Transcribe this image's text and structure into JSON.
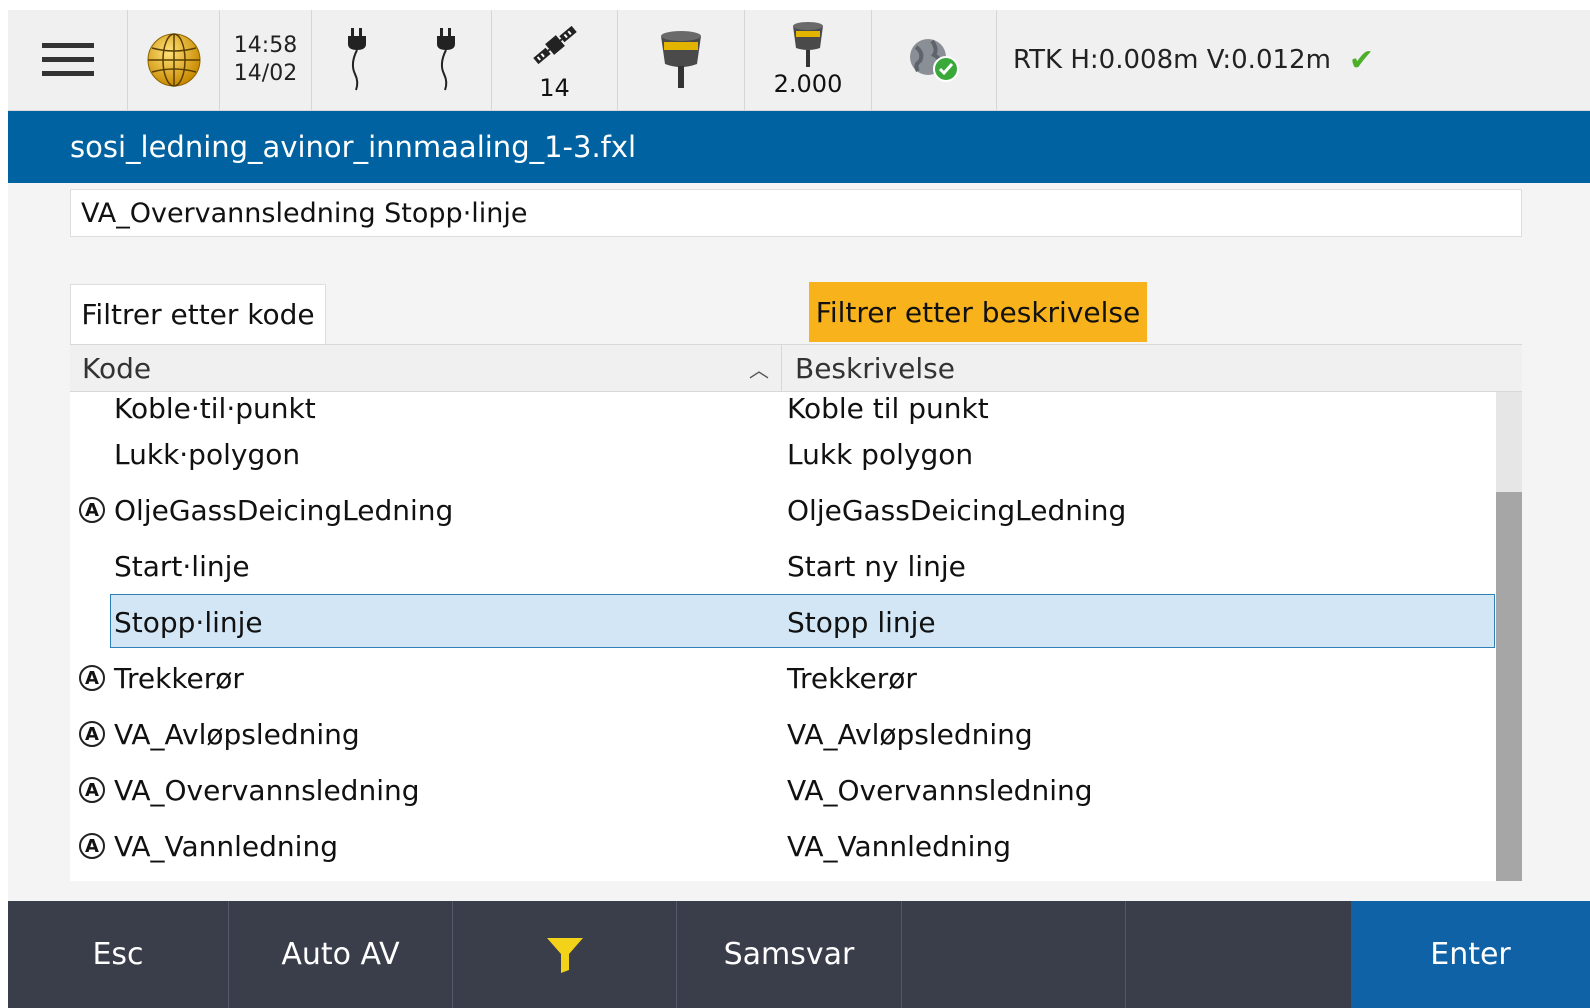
{
  "status": {
    "time": "14:58",
    "date": "14/02",
    "satellites": "14",
    "antenna_height": "2.000",
    "rtk_text": "RTK H:0.008m V:0.012m",
    "icons": [
      "menu-icon",
      "globe-icon",
      "plug-icon",
      "plug-icon",
      "satellite-icon",
      "gnss-receiver-icon",
      "receiver-height-icon",
      "network-globe-icon",
      "check-icon"
    ]
  },
  "title": "sosi_ledning_avinor_innmaaling_1-3.fxl",
  "code_field": "VA_Overvannsledning Stopp·linje",
  "filters": {
    "by_code": "Filtrer etter kode",
    "by_description": "Filtrer etter beskrivelse"
  },
  "table": {
    "headers": {
      "code": "Kode",
      "description": "Beskrivelse"
    },
    "rows": [
      {
        "code": "Koble·til·punkt",
        "description": "Koble til punkt",
        "attr": false
      },
      {
        "code": "Lukk·polygon",
        "description": "Lukk polygon",
        "attr": false
      },
      {
        "code": "OljeGassDeicingLedning",
        "description": "OljeGassDeicingLedning",
        "attr": true
      },
      {
        "code": "Start·linje",
        "description": "Start ny linje",
        "attr": false
      },
      {
        "code": "Stopp·linje",
        "description": "Stopp linje",
        "attr": false,
        "selected": true
      },
      {
        "code": "Trekkerør",
        "description": "Trekkerør",
        "attr": true
      },
      {
        "code": "VA_Avløpsledning",
        "description": "VA_Avløpsledning",
        "attr": true
      },
      {
        "code": "VA_Overvannsledning",
        "description": "VA_Overvannsledning",
        "attr": true
      },
      {
        "code": "VA_Vannledning",
        "description": "VA_Vannledning",
        "attr": true
      }
    ],
    "attr_glyph": "A"
  },
  "softkeys": {
    "esc": "Esc",
    "auto": "Auto AV",
    "filter_icon": "filter-icon",
    "match": "Samsvar",
    "enter": "Enter"
  },
  "colors": {
    "title_bar": "#0062a0",
    "filter_active": "#f7b21c",
    "selected_row": "#d2e6f5",
    "bottom_bar": "#3a3d4a",
    "enter": "#0f62a5",
    "check": "#4caf2a"
  }
}
